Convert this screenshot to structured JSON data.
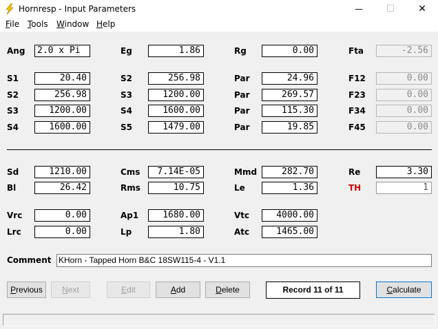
{
  "window": {
    "title": "Hornresp - Input Parameters",
    "minimize_glyph": "—",
    "maximize_glyph": "☐",
    "close_glyph": "✕"
  },
  "menu": [
    {
      "key": "F",
      "rest": "ile"
    },
    {
      "key": "T",
      "rest": "ools"
    },
    {
      "key": "W",
      "rest": "indow"
    },
    {
      "key": "H",
      "rest": "elp"
    }
  ],
  "fields": {
    "ang": {
      "label": "Ang",
      "value": "2.0 x Pi"
    },
    "eg": {
      "label": "Eg",
      "value": "1.86"
    },
    "rg": {
      "label": "Rg",
      "value": "0.00"
    },
    "fta": {
      "label": "Fta",
      "value": "-2.56"
    },
    "s1a": {
      "label": "S1",
      "value": "20.40"
    },
    "s2b": {
      "label": "S2",
      "value": "256.98"
    },
    "par1": {
      "label": "Par",
      "value": "24.96"
    },
    "f12": {
      "label": "F12",
      "value": "0.00"
    },
    "s2a": {
      "label": "S2",
      "value": "256.98"
    },
    "s3b": {
      "label": "S3",
      "value": "1200.00"
    },
    "par2": {
      "label": "Par",
      "value": "269.57"
    },
    "f23": {
      "label": "F23",
      "value": "0.00"
    },
    "s3a": {
      "label": "S3",
      "value": "1200.00"
    },
    "s4b": {
      "label": "S4",
      "value": "1600.00"
    },
    "par3": {
      "label": "Par",
      "value": "115.30"
    },
    "f34": {
      "label": "F34",
      "value": "0.00"
    },
    "s4a": {
      "label": "S4",
      "value": "1600.00"
    },
    "s5b": {
      "label": "S5",
      "value": "1479.00"
    },
    "par4": {
      "label": "Par",
      "value": "19.85"
    },
    "f45": {
      "label": "F45",
      "value": "0.00"
    },
    "sd": {
      "label": "Sd",
      "value": "1210.00"
    },
    "cms": {
      "label": "Cms",
      "value": "7.14E-05"
    },
    "mmd": {
      "label": "Mmd",
      "value": "282.70"
    },
    "re": {
      "label": "Re",
      "value": "3.30"
    },
    "bl": {
      "label": "Bl",
      "value": "26.42"
    },
    "rms": {
      "label": "Rms",
      "value": "10.75"
    },
    "le": {
      "label": "Le",
      "value": "1.36"
    },
    "th": {
      "label": "TH",
      "value": "1"
    },
    "vrc": {
      "label": "Vrc",
      "value": "0.00"
    },
    "ap1": {
      "label": "Ap1",
      "value": "1680.00"
    },
    "vtc": {
      "label": "Vtc",
      "value": "4000.00"
    },
    "lrc": {
      "label": "Lrc",
      "value": "0.00"
    },
    "lp": {
      "label": "Lp",
      "value": "1.80"
    },
    "atc": {
      "label": "Atc",
      "value": "1465.00"
    }
  },
  "comment": {
    "label": "Comment",
    "value": "KHorn - Tapped Horn B&C 18SW115-4 - V1.1"
  },
  "buttons": {
    "previous": {
      "key": "P",
      "rest": "revious"
    },
    "next": {
      "key": "N",
      "rest": "ext"
    },
    "edit": {
      "key": "E",
      "rest": "dit"
    },
    "add": {
      "key": "A",
      "rest": "dd"
    },
    "delete": {
      "key": "D",
      "rest": "elete"
    },
    "calculate": {
      "key": "C",
      "rest": "alculate"
    }
  },
  "record": "Record 11 of 11"
}
